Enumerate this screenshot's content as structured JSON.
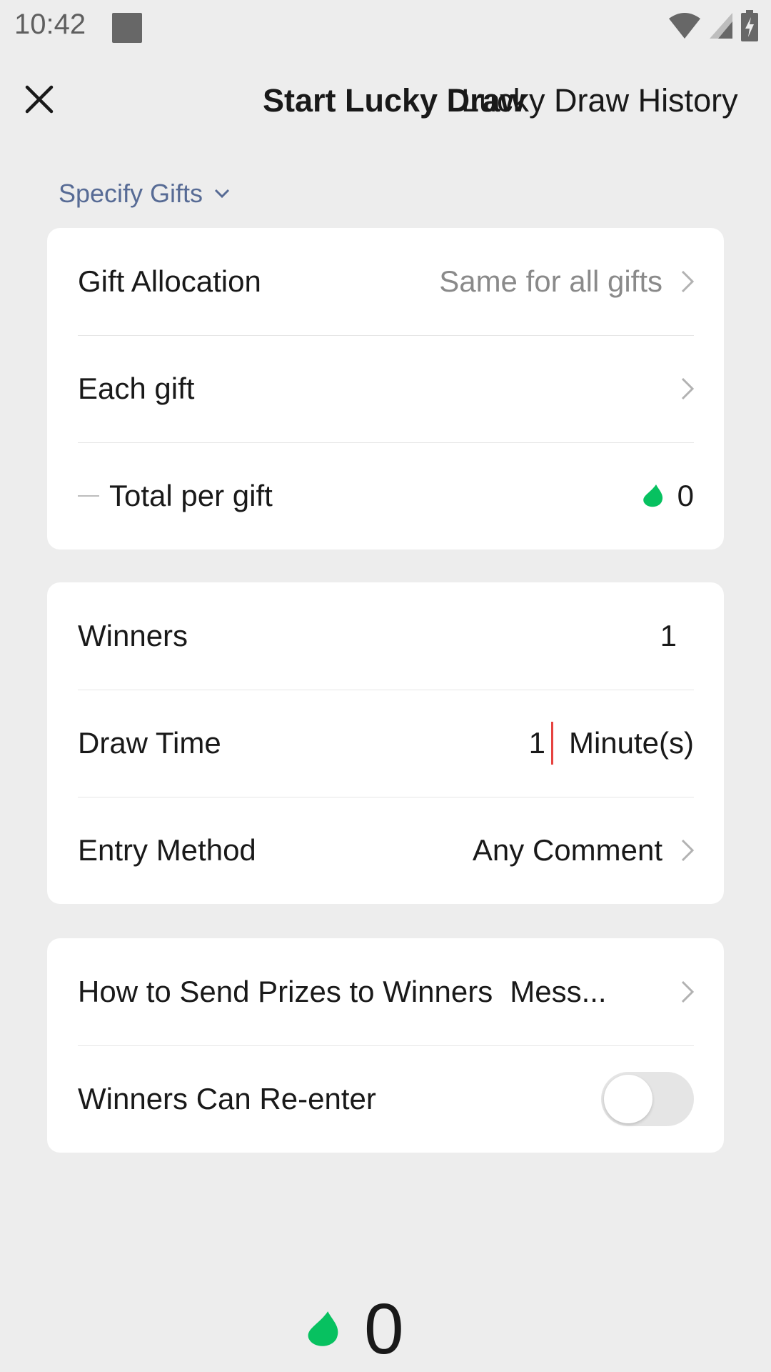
{
  "status_bar": {
    "time": "10:42"
  },
  "header": {
    "title": "Start Lucky Draw",
    "history_link": "Lucky Draw History"
  },
  "specify_gifts": {
    "label": "Specify Gifts"
  },
  "gift_card": {
    "allocation_label": "Gift Allocation",
    "allocation_value": "Same for all gifts",
    "each_gift_label": "Each gift",
    "total_label": "Total per gift",
    "total_value": "0"
  },
  "settings_card": {
    "winners_label": "Winners",
    "winners_value": "1",
    "draw_time_label": "Draw Time",
    "draw_time_value": "1",
    "draw_time_unit": "Minute(s)",
    "entry_label": "Entry Method",
    "entry_value": "Any Comment"
  },
  "prize_card": {
    "send_label": "How to Send Prizes to Winners",
    "send_value": "Mess...",
    "reenter_label": "Winners Can Re-enter",
    "reenter_on": false
  },
  "bottom": {
    "total": "0"
  },
  "colors": {
    "background": "#EDEDED",
    "accent_green": "#07C160",
    "link_blue": "#576B95",
    "cursor_red": "#E64340"
  },
  "icons": [
    "close-icon",
    "chevron-down-icon",
    "chevron-right-icon",
    "leaf-coin-icon",
    "wifi-icon",
    "signal-icon",
    "battery-icon"
  ]
}
